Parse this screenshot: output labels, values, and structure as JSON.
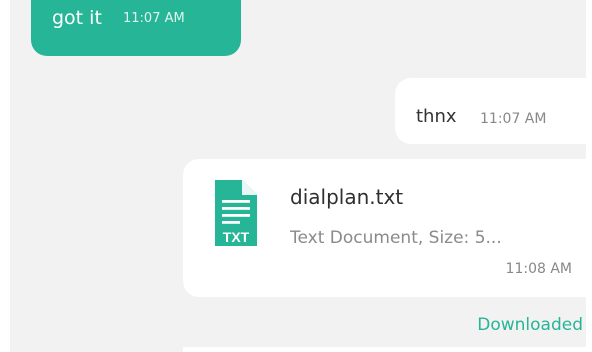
{
  "messages": [
    {
      "direction": "incoming",
      "text": "got it",
      "time": "11:07 AM"
    },
    {
      "direction": "outgoing",
      "text": "thnx",
      "time": "11:07 AM"
    }
  ],
  "file_message": {
    "icon": "txt-document-icon",
    "icon_label": "TXT",
    "name": "dialplan.txt",
    "meta": "Text Document, Size: 5...",
    "time": "11:08 AM",
    "status": "Downloaded"
  },
  "colors": {
    "accent": "#26b597",
    "incoming_bubble": "#26b597",
    "outgoing_bubble": "#ffffff",
    "chat_background": "#f2f2f2",
    "timestamp": "#888888"
  }
}
